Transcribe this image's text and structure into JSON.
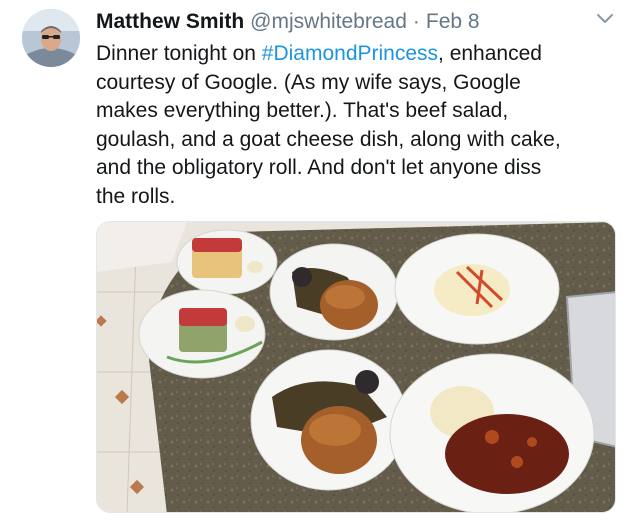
{
  "tweet": {
    "author": {
      "name": "Matthew Smith",
      "handle": "@mjswhitebread"
    },
    "separator": "·",
    "date": "Feb 8",
    "text_lines": [
      [
        "Dinner tonight on ",
        "#DiamondPrincess",
        ", enhanced"
      ],
      [
        "courtesy of Google.  (As my wife says, Google"
      ],
      [
        "makes everything better.). That's beef salad,"
      ],
      [
        "goulash, and a goat cheese dish, along with cake,"
      ],
      [
        "and the obligatory roll.  And don't let anyone diss"
      ],
      [
        "the rolls."
      ]
    ],
    "hashtag": "#DiamondPrincess",
    "colors": {
      "text": "#14171a",
      "secondary": "#657786",
      "link": "#1b95e0"
    },
    "icons": {
      "more": "chevron-down-icon",
      "avatar": "avatar"
    }
  }
}
